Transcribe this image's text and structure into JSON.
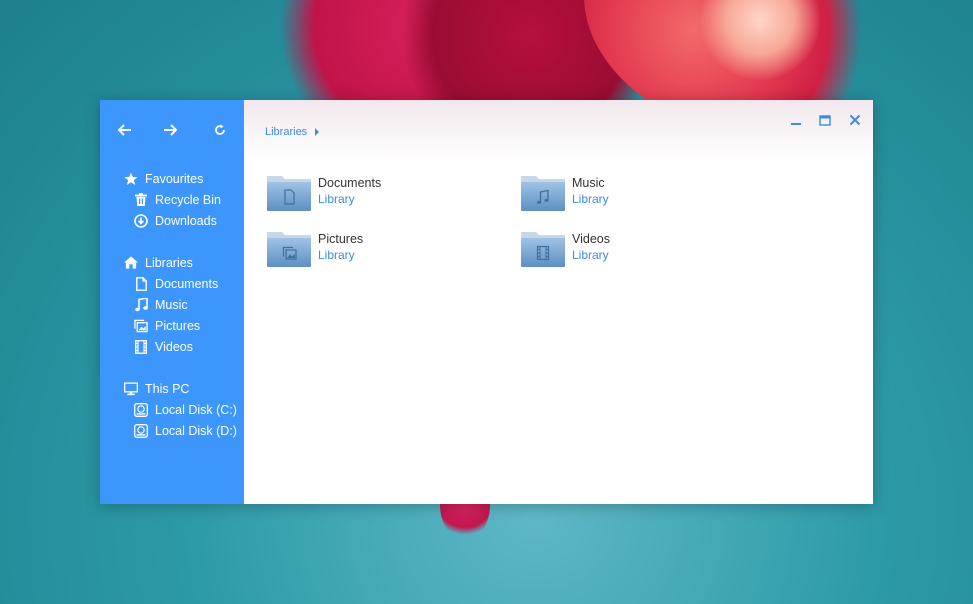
{
  "wallpaper": {
    "colors": [
      "#2d9aa8",
      "#c01448",
      "#e2384f"
    ]
  },
  "titlebar": {
    "back_icon": "arrow-left-icon",
    "forward_icon": "arrow-right-icon",
    "refresh_icon": "refresh-icon",
    "minimize_icon": "minimize-icon",
    "maximize_icon": "maximize-icon",
    "close_icon": "close-icon"
  },
  "breadcrumb": {
    "current": "Libraries"
  },
  "sidebar": {
    "accent": "#3d96fb",
    "favourites": {
      "label": "Favourites",
      "icon": "star-icon",
      "items": [
        {
          "label": "Recycle Bin",
          "icon": "trash-icon"
        },
        {
          "label": "Downloads",
          "icon": "download-icon"
        }
      ]
    },
    "libraries": {
      "label": "Libraries",
      "icon": "home-icon",
      "active": true,
      "items": [
        {
          "label": "Documents",
          "icon": "document-icon"
        },
        {
          "label": "Music",
          "icon": "music-note-icon"
        },
        {
          "label": "Pictures",
          "icon": "pictures-icon"
        },
        {
          "label": "Videos",
          "icon": "film-icon"
        }
      ]
    },
    "thispc": {
      "label": "This PC",
      "icon": "monitor-icon",
      "items": [
        {
          "label": "Local Disk (C:)",
          "icon": "disk-icon"
        },
        {
          "label": "Local Disk (D:)",
          "icon": "disk-icon"
        }
      ]
    }
  },
  "libraries": [
    {
      "name": "Documents",
      "type": "Library",
      "icon": "folder-document-icon"
    },
    {
      "name": "Music",
      "type": "Library",
      "icon": "folder-music-icon"
    },
    {
      "name": "Pictures",
      "type": "Library",
      "icon": "folder-pictures-icon"
    },
    {
      "name": "Videos",
      "type": "Library",
      "icon": "folder-videos-icon"
    }
  ]
}
